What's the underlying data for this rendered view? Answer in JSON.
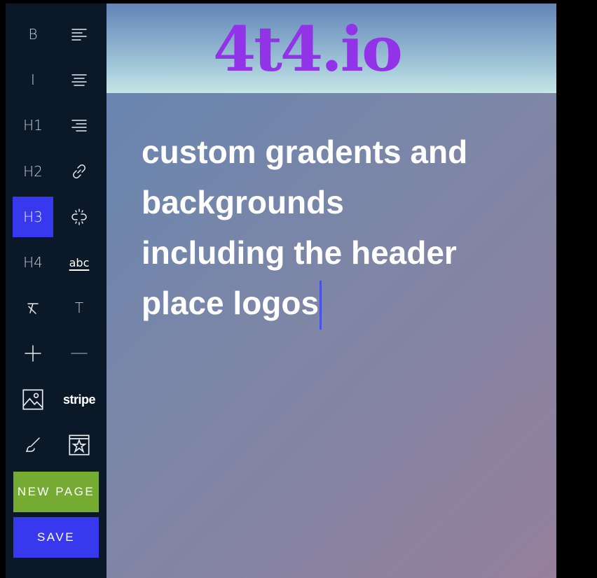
{
  "toolbar": {
    "tools": [
      {
        "label": "B",
        "icon": "bold-icon"
      },
      {
        "label": "",
        "icon": "align-left-icon"
      },
      {
        "label": "I",
        "icon": "italic-icon"
      },
      {
        "label": "",
        "icon": "align-center-icon"
      },
      {
        "label": "H1",
        "icon": "heading1-icon"
      },
      {
        "label": "",
        "icon": "align-right-icon"
      },
      {
        "label": "H2",
        "icon": "heading2-icon"
      },
      {
        "label": "",
        "icon": "link-icon"
      },
      {
        "label": "H3",
        "icon": "heading3-icon",
        "active": true
      },
      {
        "label": "",
        "icon": "unlink-icon"
      },
      {
        "label": "H4",
        "icon": "heading4-icon"
      },
      {
        "label": "abc",
        "icon": "strikethrough-icon"
      },
      {
        "label": "",
        "icon": "clear-format-icon"
      },
      {
        "label": "T",
        "icon": "text-icon"
      },
      {
        "label": "",
        "icon": "plus-icon"
      },
      {
        "label": "",
        "icon": "minus-icon"
      },
      {
        "label": "",
        "icon": "image-icon"
      },
      {
        "label": "stripe",
        "icon": "stripe-icon"
      },
      {
        "label": "",
        "icon": "paint-brush-icon"
      },
      {
        "label": "",
        "icon": "browser-star-icon"
      }
    ],
    "new_page_label": "NEW PAGE",
    "save_label": "SAVE"
  },
  "header": {
    "logo_text": "4t4.io"
  },
  "content": {
    "line1": "custom gradents and",
    "line2": "backgrounds",
    "line3": "including the header",
    "line4": "place logos"
  },
  "colors": {
    "toolbar_bg": "#0a1828",
    "active": "#3838ee",
    "new_page": "#75ab33",
    "save": "#3838ee",
    "logo": "#9333e8"
  }
}
